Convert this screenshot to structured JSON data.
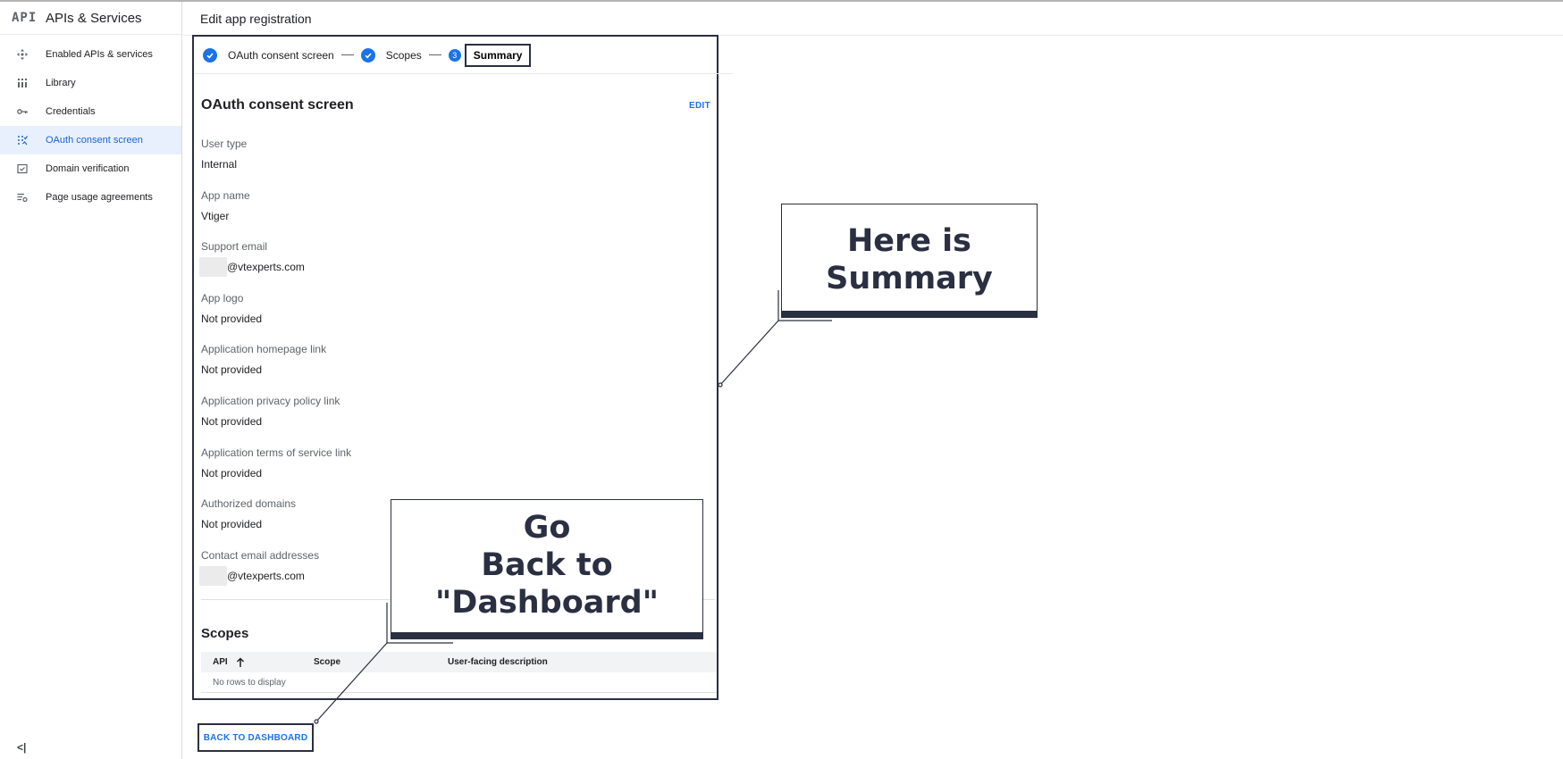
{
  "sidebar": {
    "logo": "API",
    "title": "APIs & Services",
    "items": [
      {
        "label": "Enabled APIs & services",
        "icon": "diamond-arrows-icon"
      },
      {
        "label": "Library",
        "icon": "library-grid-icon"
      },
      {
        "label": "Credentials",
        "icon": "key-icon"
      },
      {
        "label": "OAuth consent screen",
        "icon": "consent-dots-icon",
        "active": true
      },
      {
        "label": "Domain verification",
        "icon": "checkbox-icon"
      },
      {
        "label": "Page usage agreements",
        "icon": "list-settings-icon"
      }
    ],
    "collapse": "<|"
  },
  "header": {
    "title": "Edit app registration"
  },
  "stepper": {
    "steps": [
      {
        "label": "OAuth consent screen",
        "state": "done"
      },
      {
        "label": "Scopes",
        "state": "done"
      },
      {
        "number": "3",
        "label": "Summary",
        "state": "current"
      }
    ]
  },
  "summary": {
    "section_title": "OAuth consent screen",
    "edit_label": "EDIT",
    "fields": [
      {
        "label": "User type",
        "value": "Internal"
      },
      {
        "label": "App name",
        "value": "Vtiger"
      },
      {
        "label": "Support email",
        "value": "@vtexperts.com",
        "redacted_prefix": true
      },
      {
        "label": "App logo",
        "value": "Not provided"
      },
      {
        "label": "Application homepage link",
        "value": "Not provided"
      },
      {
        "label": "Application privacy policy link",
        "value": "Not provided"
      },
      {
        "label": "Application terms of service link",
        "value": "Not provided"
      },
      {
        "label": "Authorized domains",
        "value": "Not provided"
      },
      {
        "label": "Contact email addresses",
        "value": "@vtexperts.com",
        "redacted_prefix": true
      }
    ],
    "scopes": {
      "title": "Scopes",
      "columns": [
        "API",
        "Scope",
        "User-facing description"
      ],
      "empty_text": "No rows to display"
    }
  },
  "actions": {
    "back_label": "BACK TO DASHBOARD"
  },
  "callouts": {
    "summary": [
      "Here is",
      "Summary"
    ],
    "dashboard": [
      "Go",
      "Back to",
      "\"Dashboard\""
    ]
  },
  "colors": {
    "accent": "#1a73e8",
    "callout": "#2b2f42",
    "active_bg": "#e8f0fe"
  }
}
